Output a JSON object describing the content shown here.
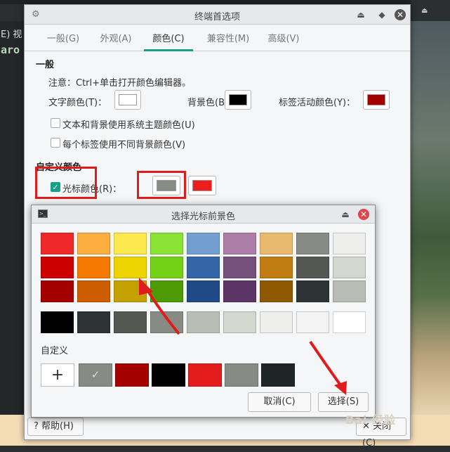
{
  "background": {
    "terminal_menu": "E) 视",
    "terminal_text": "aro"
  },
  "prefs": {
    "title": "终端首选项",
    "tabs": [
      {
        "label": "一般(G)"
      },
      {
        "label": "外观(A)"
      },
      {
        "label": "颜色(C)",
        "active": true
      },
      {
        "label": "兼容性(M)"
      },
      {
        "label": "高级(V)"
      }
    ],
    "general_section": "一般",
    "note": "注意：Ctrl+单击打开颜色编辑器。",
    "text_color_label": "文字颜色(T)：",
    "bg_color_label": "背景色(B)：",
    "tab_active_color_label": "标签活动颜色(Y)：",
    "text_color": "#ffffff",
    "bg_color": "#000000",
    "tab_active_color": "#a40000",
    "use_theme_label": "文本和背景使用系统主题颜色(U)",
    "use_theme_checked": false,
    "per_tab_label": "每个标签使用不同背景颜色(V)",
    "per_tab_checked": false,
    "custom_section": "自定义颜色",
    "cursor_color_label": "光标颜色(R)：",
    "cursor_color_checked": true,
    "cursor_fg": "#888a85",
    "cursor_bg": "#ef1c1c",
    "help_button": "帮助(H)",
    "close_button": "关闭(C)"
  },
  "chooser": {
    "title": "选择光标前景色",
    "palette_columns": [
      [
        "#ef2929",
        "#cc0000",
        "#a40000"
      ],
      [
        "#fcaf3e",
        "#f57900",
        "#ce5c00"
      ],
      [
        "#fce94f",
        "#edd400",
        "#c4a000"
      ],
      [
        "#8ae234",
        "#73d216",
        "#4e9a06"
      ],
      [
        "#729fcf",
        "#3465a4",
        "#204a87"
      ],
      [
        "#ad7fa8",
        "#75507b",
        "#5c3566"
      ],
      [
        "#e9b96e",
        "#c17d11",
        "#8f5902"
      ],
      [
        "#888a85",
        "#555753",
        "#2e3436"
      ],
      [
        "#eeeeec",
        "#d3d7cf",
        "#babdb6"
      ]
    ],
    "gray_row": [
      "#000000",
      "#2e3436",
      "#555753",
      "#888a85",
      "#babdb6",
      "#d3d7cf",
      "#eeeeec",
      "#f3f3f3",
      "#ffffff"
    ],
    "custom_label": "自定义",
    "add_label": "+",
    "custom_colors": [
      "#888a85",
      "#a40000",
      "#000000",
      "#e51c1c",
      "#888a85",
      "#1f2426"
    ],
    "selected_custom_index": 0,
    "cancel_button": "取消(C)",
    "select_button": "选择(S)"
  },
  "watermark": "Bai 经验"
}
